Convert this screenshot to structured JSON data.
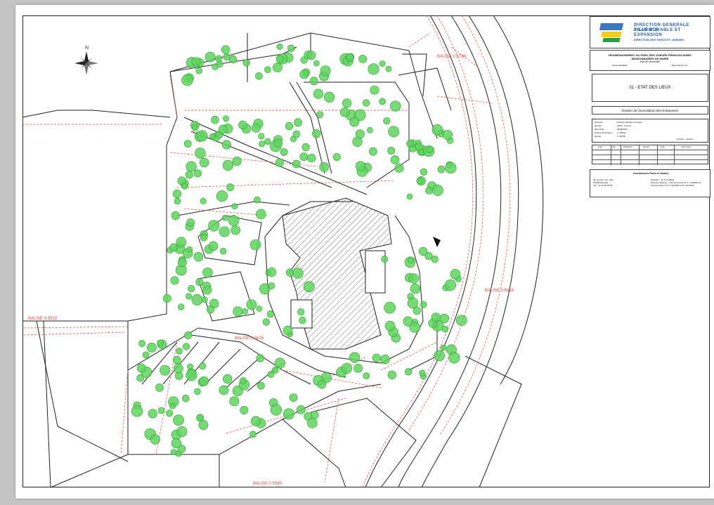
{
  "sheet": {
    "north_label": "N",
    "street_labels": [
      "BALISE 0.5780",
      "BALISE 0.5510",
      "BALISE 0.5615",
      "BALISE 0.5616",
      "BALISE 0.5580"
    ]
  },
  "cartouche": {
    "direction_line1": "DIRECTION GENERALE ADJOINTE",
    "direction_line2": "VILLE DURABLE ET EXPANSION",
    "direction_line3": "DIRECTION DES PARCS ET JARDINS",
    "project_line1": "REAMENAGEMENT DU PARC DES SOEURS FRANCISCAINES",
    "project_line2": "MISSIONNAIRES DE MARIE",
    "project_line3": "Etat de conformité",
    "project_foot_left": "Etude faisabilité",
    "project_foot_right": "Etat initial du site",
    "sheet_title": "01 - ETAT DES LIEUX",
    "dossier": "Dossier de Consultation des Entreprises",
    "info": [
      {
        "key": "Direction",
        "value": "Direction Études et Projets"
      },
      {
        "key": "Echelle",
        "value": "1/500 - Format"
      },
      {
        "key": "Date DCE",
        "value": "03/08/2021"
      },
      {
        "key": "Études Techniques",
        "value": "A. BOZE"
      },
      {
        "key": "Dessin",
        "value": "A. BOZE"
      }
    ],
    "quartier": "Quartier : Vauban",
    "revision_headers": [
      "Indice",
      "Date",
      "Modification",
      "Dessiné",
      "Vérifié",
      "Observations"
    ],
    "contacts_title": "Coordonnées Parcs et Jardins",
    "address_lines": [
      "48, avenue Clot - Bey",
      "13008 Marseille",
      "Tél. : 04 91 55 25 56"
    ],
    "contact_lines": [
      "Directeur : M. R. TOMAS",
      "Direction adjointe : Chef de service M. D. GUERRA &",
      "chef de division M. S. MAURIN & M. CROISSY"
    ]
  },
  "colors": {
    "sheet_background": "#ffffff",
    "viewer_background": "#c4c4c4",
    "tree": "#5fd35f",
    "tree_dark": "#2e9e2e",
    "levels": "#e04545",
    "lines": "#222222",
    "accent_blue": "#1e5aa8",
    "accent_yellow": "#f3cc20",
    "accent_green": "#2f9c4a"
  },
  "icons": {
    "north_arrow": "compass-rose-icon",
    "logo": "city-logo-icon"
  }
}
